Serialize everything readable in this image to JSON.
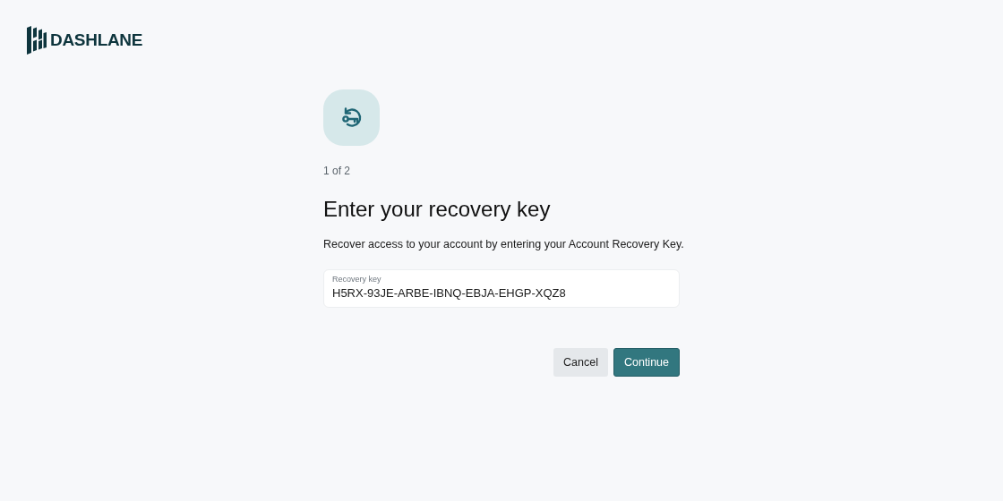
{
  "logo": {
    "text": "DASHLANE"
  },
  "step": "1 of 2",
  "title": "Enter your recovery key",
  "description": "Recover access to your account by entering your Account Recovery Key.",
  "field": {
    "label": "Recovery key",
    "value": "H5RX-93JE-ARBE-IBNQ-EBJA-EHGP-XQZ8"
  },
  "buttons": [
    {
      "label": "Cancel",
      "kind": "secondary"
    },
    {
      "label": "Continue",
      "kind": "primary"
    }
  ]
}
